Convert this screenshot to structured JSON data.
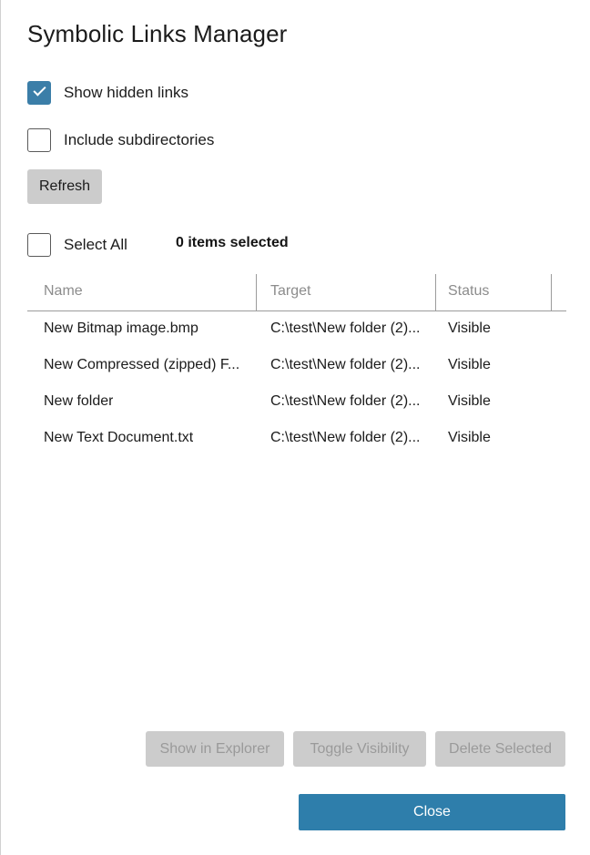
{
  "dialog": {
    "title": "Symbolic Links Manager"
  },
  "options": {
    "show_hidden": {
      "label": "Show hidden links",
      "checked": true
    },
    "include_subdirectories": {
      "label": "Include subdirectories",
      "checked": false
    },
    "refresh_label": "Refresh"
  },
  "selection": {
    "select_all_label": "Select All",
    "select_all_checked": false,
    "count_text": "0 items selected"
  },
  "table": {
    "columns": [
      "Name",
      "Target",
      "Status"
    ],
    "rows": [
      {
        "name": "New Bitmap image.bmp",
        "target": "C:\\test\\New folder (2)...",
        "status": "Visible"
      },
      {
        "name": "New Compressed (zipped) F...",
        "target": "C:\\test\\New folder (2)...",
        "status": "Visible"
      },
      {
        "name": "New folder",
        "target": "C:\\test\\New folder (2)...",
        "status": "Visible"
      },
      {
        "name": "New Text Document.txt",
        "target": "C:\\test\\New folder (2)...",
        "status": "Visible"
      }
    ]
  },
  "actions": {
    "show_in_explorer": "Show in Explorer",
    "toggle_visibility": "Toggle Visibility",
    "delete_selected": "Delete Selected",
    "close": "Close"
  },
  "colors": {
    "accent": "#2e7eab",
    "checkbox_checked": "#3b7ea8",
    "button_disabled_bg": "#cccccc",
    "button_disabled_text": "#9a9a9a",
    "header_text": "#8c8c8c",
    "rule": "#9b9b9b"
  }
}
